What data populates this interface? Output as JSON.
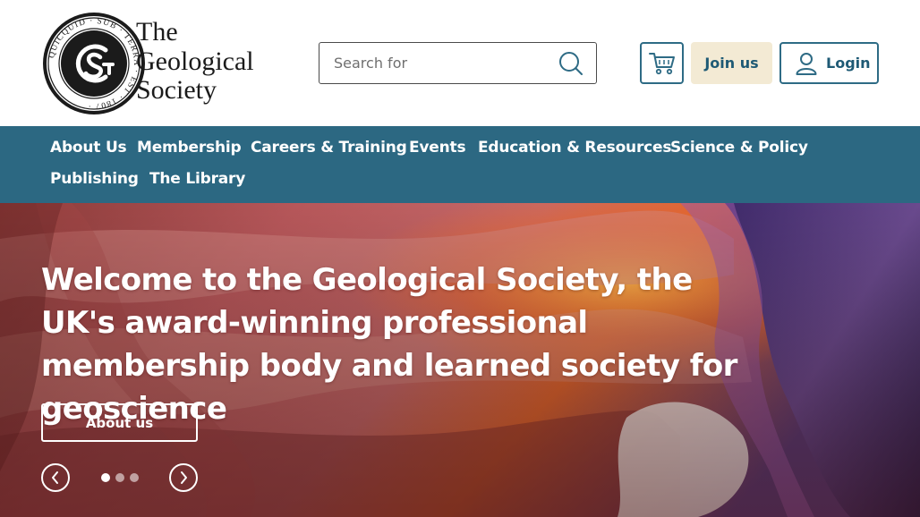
{
  "site": {
    "logo_lines": [
      "The",
      "Geological",
      "Society"
    ],
    "seal_text": "QUICQUID SUB TERRA EST 1807"
  },
  "search": {
    "placeholder": "Search for"
  },
  "header_actions": {
    "join_label": "Join us",
    "login_label": "Login"
  },
  "nav": {
    "items": [
      {
        "label": "About Us"
      },
      {
        "label": "Membership"
      },
      {
        "label": "Careers & Training"
      },
      {
        "label": "Events"
      },
      {
        "label": "Education & Resources"
      },
      {
        "label": "Science & Policy"
      },
      {
        "label": "Publishing"
      },
      {
        "label": "The Library"
      }
    ]
  },
  "hero": {
    "title": "Welcome to the Geological Society, the UK's award-winning professional membership body and learned society for geoscience",
    "cta_label": "About us",
    "slide_count": 3,
    "active_slide": 1
  },
  "colors": {
    "brand_blue": "#2c6882",
    "join_bg": "#f3ead4",
    "link_blue": "#1e5a75"
  },
  "icons": [
    "search-icon",
    "cart-icon",
    "user-icon",
    "chevron-left-icon",
    "chevron-right-icon"
  ]
}
